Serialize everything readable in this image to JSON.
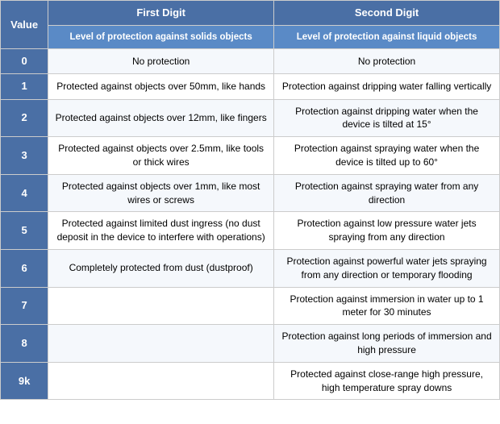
{
  "table": {
    "col1_header": "First Digit",
    "col2_header": "Second Digit",
    "col1_sub": "Level of protection against solids objects",
    "col2_sub": "Level of protection against liquid objects",
    "value_label": "Value",
    "rows": [
      {
        "value": "0",
        "solid": "No protection",
        "liquid": "No protection"
      },
      {
        "value": "1",
        "solid": "Protected against objects over 50mm, like hands",
        "liquid": "Protection against dripping water falling vertically"
      },
      {
        "value": "2",
        "solid": "Protected against objects over 12mm, like fingers",
        "liquid": "Protection against dripping water when the device is tilted at 15°"
      },
      {
        "value": "3",
        "solid": "Protected against objects over 2.5mm, like tools or thick wires",
        "liquid": "Protection against spraying water when the device is tilted up to 60°"
      },
      {
        "value": "4",
        "solid": "Protected against objects over 1mm, like most wires or screws",
        "liquid": "Protection against spraying water from any direction"
      },
      {
        "value": "5",
        "solid": "Protected against limited dust ingress (no dust deposit in the device to interfere with operations)",
        "liquid": "Protection against low pressure water jets spraying from any direction"
      },
      {
        "value": "6",
        "solid": "Completely protected from dust (dustproof)",
        "liquid": "Protection against powerful water jets spraying from any direction or temporary flooding"
      },
      {
        "value": "7",
        "solid": "",
        "liquid": "Protection against immersion in water up to 1 meter for 30 minutes"
      },
      {
        "value": "8",
        "solid": "",
        "liquid": "Protection against long periods of immersion and high pressure"
      },
      {
        "value": "9k",
        "solid": "",
        "liquid": "Protected against close-range high pressure, high temperature spray downs"
      }
    ]
  }
}
